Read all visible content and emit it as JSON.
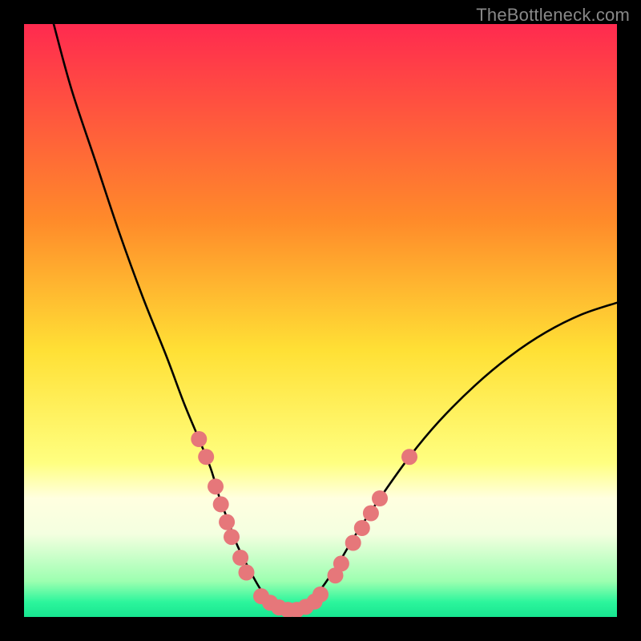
{
  "watermark": "TheBottleneck.com",
  "chart_data": {
    "type": "line",
    "title": "",
    "xlabel": "",
    "ylabel": "",
    "xlim": [
      0,
      100
    ],
    "ylim": [
      0,
      100
    ],
    "gradient_stops": [
      {
        "pos": 0.0,
        "color": "#ff2a4f"
      },
      {
        "pos": 0.33,
        "color": "#ff8a2a"
      },
      {
        "pos": 0.55,
        "color": "#ffe035"
      },
      {
        "pos": 0.74,
        "color": "#ffff80"
      },
      {
        "pos": 0.8,
        "color": "#ffffe0"
      },
      {
        "pos": 0.86,
        "color": "#f4ffe0"
      },
      {
        "pos": 0.94,
        "color": "#9cffb0"
      },
      {
        "pos": 0.975,
        "color": "#2cf59c"
      },
      {
        "pos": 1.0,
        "color": "#17e590"
      }
    ],
    "series": [
      {
        "name": "bottleneck-curve",
        "x": [
          5,
          8,
          12,
          16,
          20,
          24,
          27,
          29.5,
          31.5,
          33,
          34.5,
          36,
          38,
          40,
          42,
          44,
          46,
          48,
          50,
          53,
          56,
          60,
          65,
          70,
          76,
          82,
          88,
          94,
          100
        ],
        "y": [
          100,
          89,
          77,
          65,
          54,
          44,
          36,
          30,
          25,
          20,
          16,
          12,
          8,
          4.5,
          2.2,
          1.2,
          1.2,
          2.2,
          4.6,
          9,
          14,
          20,
          27,
          33,
          39,
          44,
          48,
          51,
          53
        ]
      }
    ],
    "markers": {
      "name": "highlight-dots",
      "color": "#e6777a",
      "radius": 10,
      "points": [
        {
          "x": 29.5,
          "y": 30
        },
        {
          "x": 30.7,
          "y": 27
        },
        {
          "x": 32.3,
          "y": 22
        },
        {
          "x": 33.2,
          "y": 19
        },
        {
          "x": 34.2,
          "y": 16
        },
        {
          "x": 35.0,
          "y": 13.5
        },
        {
          "x": 36.5,
          "y": 10
        },
        {
          "x": 37.5,
          "y": 7.5
        },
        {
          "x": 40.0,
          "y": 3.5
        },
        {
          "x": 41.5,
          "y": 2.4
        },
        {
          "x": 43.0,
          "y": 1.6
        },
        {
          "x": 44.5,
          "y": 1.2
        },
        {
          "x": 46.0,
          "y": 1.2
        },
        {
          "x": 47.5,
          "y": 1.7
        },
        {
          "x": 49.0,
          "y": 2.6
        },
        {
          "x": 50.0,
          "y": 3.8
        },
        {
          "x": 52.5,
          "y": 7
        },
        {
          "x": 53.5,
          "y": 9
        },
        {
          "x": 55.5,
          "y": 12.5
        },
        {
          "x": 57.0,
          "y": 15
        },
        {
          "x": 58.5,
          "y": 17.5
        },
        {
          "x": 60.0,
          "y": 20
        },
        {
          "x": 65.0,
          "y": 27
        }
      ]
    }
  }
}
